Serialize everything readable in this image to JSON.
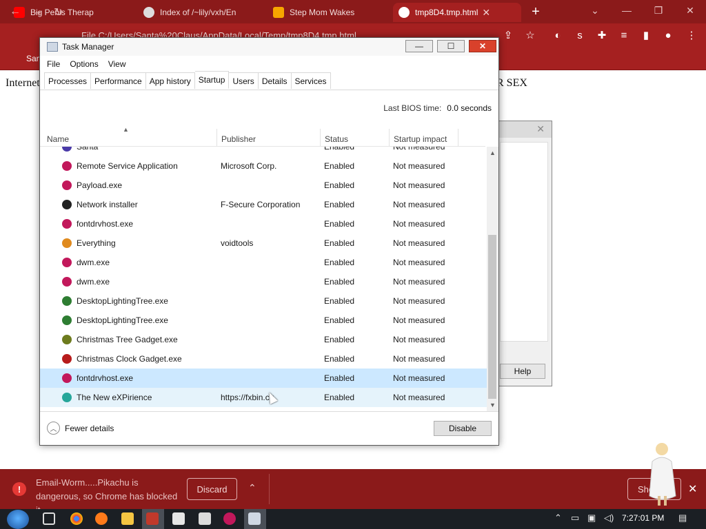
{
  "browser": {
    "tabs": [
      {
        "title": "Big Penis Therap",
        "favicon_color": "#ff0000"
      },
      {
        "title": "Index of /~lily/vxh/En",
        "favicon_color": "#dddddd"
      },
      {
        "title": "Step Mom Wakes",
        "favicon_color": "#f7a600"
      },
      {
        "title": "tmp8D4.tmp.html",
        "favicon_color": "#ffffff"
      }
    ],
    "address": "File   C:/Users/Santa%20Claus/AppData/Local/Temp/tmp8D4.tmp.html",
    "bookmark": "San",
    "page_text_left": "Internet",
    "page_text_right": "R SEX"
  },
  "bg_dialog": {
    "help_label": "Help"
  },
  "task_manager": {
    "title": "Task Manager",
    "menu": [
      "File",
      "Options",
      "View"
    ],
    "tabs": [
      "Processes",
      "Performance",
      "App history",
      "Startup",
      "Users",
      "Details",
      "Services"
    ],
    "active_tab": "Startup",
    "bios_label": "Last BIOS time:",
    "bios_value": "0.0 seconds",
    "columns": [
      "Name",
      "Publisher",
      "Status",
      "Startup impact"
    ],
    "rows": [
      {
        "name": "Santa",
        "publisher": "",
        "status": "Enabled",
        "impact": "Not measured",
        "icon_color": "#4a3aa8"
      },
      {
        "name": "Remote Service Application",
        "publisher": "Microsoft Corp.",
        "status": "Enabled",
        "impact": "Not measured",
        "icon_color": "#c2185b"
      },
      {
        "name": "Payload.exe",
        "publisher": "",
        "status": "Enabled",
        "impact": "Not measured",
        "icon_color": "#c2185b"
      },
      {
        "name": "Network installer",
        "publisher": "F-Secure Corporation",
        "status": "Enabled",
        "impact": "Not measured",
        "icon_color": "#222222"
      },
      {
        "name": "fontdrvhost.exe",
        "publisher": "",
        "status": "Enabled",
        "impact": "Not measured",
        "icon_color": "#c2185b"
      },
      {
        "name": "Everything",
        "publisher": "voidtools",
        "status": "Enabled",
        "impact": "Not measured",
        "icon_color": "#e08a1e"
      },
      {
        "name": "dwm.exe",
        "publisher": "",
        "status": "Enabled",
        "impact": "Not measured",
        "icon_color": "#c2185b"
      },
      {
        "name": "dwm.exe",
        "publisher": "",
        "status": "Enabled",
        "impact": "Not measured",
        "icon_color": "#c2185b"
      },
      {
        "name": "DesktopLightingTree.exe",
        "publisher": "",
        "status": "Enabled",
        "impact": "Not measured",
        "icon_color": "#2e7d32"
      },
      {
        "name": "DesktopLightingTree.exe",
        "publisher": "",
        "status": "Enabled",
        "impact": "Not measured",
        "icon_color": "#2e7d32"
      },
      {
        "name": "Christmas Tree Gadget.exe",
        "publisher": "",
        "status": "Enabled",
        "impact": "Not measured",
        "icon_color": "#6d7b1e"
      },
      {
        "name": "Christmas Clock Gadget.exe",
        "publisher": "",
        "status": "Enabled",
        "impact": "Not measured",
        "icon_color": "#b71c1c"
      },
      {
        "name": "fontdrvhost.exe",
        "publisher": "",
        "status": "Enabled",
        "impact": "Not measured",
        "icon_color": "#c2185b"
      },
      {
        "name": "The New eXPirience",
        "publisher": "https://fxbin.cq",
        "status": "Enabled",
        "impact": "Not measured",
        "icon_color": "#26a69a"
      }
    ],
    "fewer_details": "Fewer details",
    "disable_label": "Disable"
  },
  "download_bar": {
    "message": "Email-Worm.....Pikachu is dangerous, so Chrome has blocked it.",
    "discard_label": "Discard",
    "show_all_label": "Show"
  },
  "taskbar": {
    "clock": "7:27:01 PM"
  }
}
